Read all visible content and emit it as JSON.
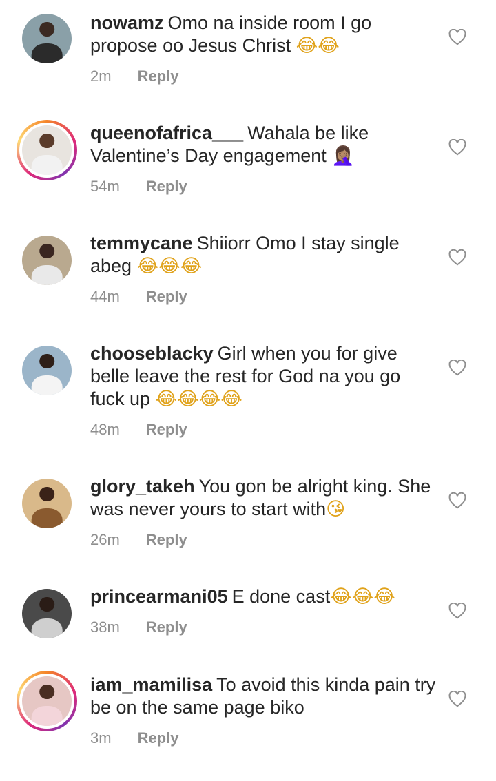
{
  "comments": [
    {
      "username": "nowamz",
      "text": "Omo na inside room I go propose oo Jesus Christ",
      "emoji": "😂😂",
      "time": "2m",
      "reply_label": "Reply",
      "avatar": {
        "story": false,
        "bg": "#8aa0a8",
        "head": "#3b2a22",
        "body": "#2b2b2b"
      }
    },
    {
      "username": "queenofafrica___",
      "text": "Wahala be like Valentine’s Day engagement",
      "emoji": "🤦🏽‍♀️",
      "time": "54m",
      "reply_label": "Reply",
      "avatar": {
        "story": true,
        "bg": "#e8e4df",
        "head": "#5a3b2a",
        "body": "#f2f2f2"
      }
    },
    {
      "username": "temmycane",
      "text": "Shiiorr Omo I stay single abeg",
      "emoji": "😂😂😂",
      "time": "44m",
      "reply_label": "Reply",
      "avatar": {
        "story": false,
        "bg": "#b9a98f",
        "head": "#3a2620",
        "body": "#e9e9e9"
      }
    },
    {
      "username": "chooseblacky",
      "text": "Girl when you for give belle leave the rest for God na you go fuck up",
      "emoji": "😂😂😂😂",
      "time": "48m",
      "reply_label": "Reply",
      "avatar": {
        "story": false,
        "bg": "#9bb5c9",
        "head": "#2e1f18",
        "body": "#f4f4f4"
      }
    },
    {
      "username": "glory_takeh",
      "text": "You gon be alright king. She was never yours to start with",
      "emoji": "😘",
      "time": "26m",
      "reply_label": "Reply",
      "avatar": {
        "story": false,
        "bg": "#d9b98a",
        "head": "#3a2218",
        "body": "#8a5a2f"
      }
    },
    {
      "username": "princearmani05",
      "text": "E done cast",
      "emoji": "😂😂😂",
      "time": "38m",
      "reply_label": "Reply",
      "avatar": {
        "story": false,
        "bg": "#4a4a4a",
        "head": "#2a1c16",
        "body": "#cfcfcf"
      }
    },
    {
      "username": "iam_mamilisa",
      "text": "To avoid  this kinda pain try be on the same page biko",
      "emoji": "",
      "time": "3m",
      "reply_label": "Reply",
      "avatar": {
        "story": true,
        "bg": "#e6c7c4",
        "head": "#4a2e22",
        "body": "#f3d5da"
      }
    }
  ]
}
